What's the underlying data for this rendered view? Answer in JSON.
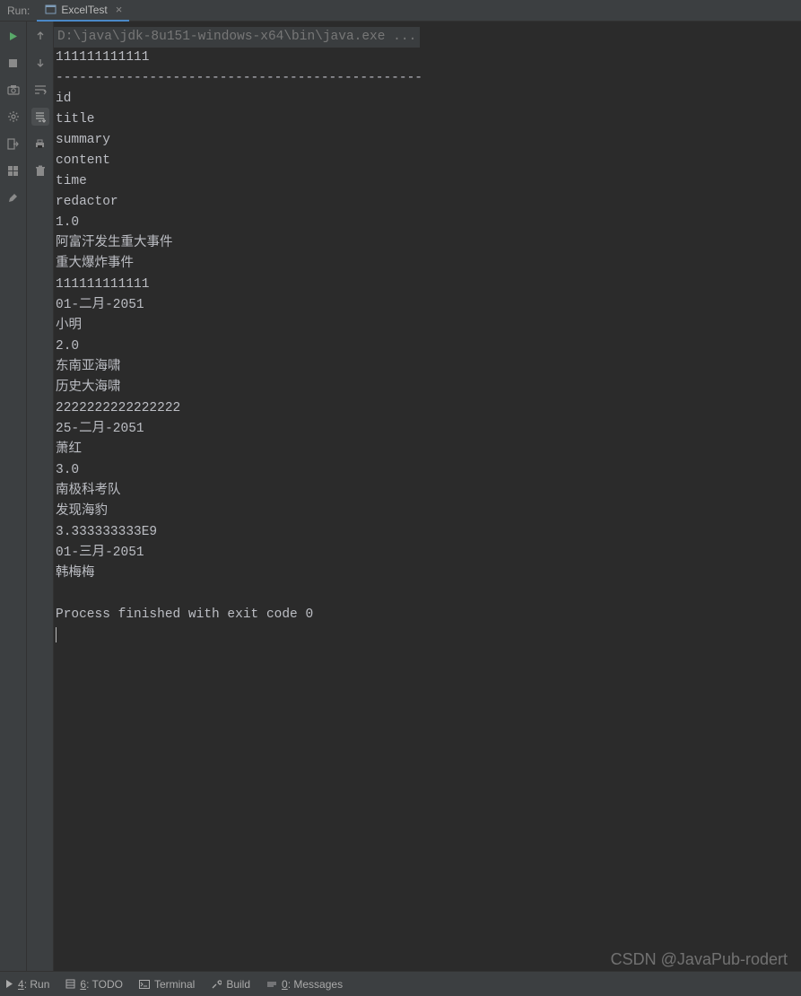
{
  "header": {
    "label": "Run:",
    "tab": {
      "label": "ExcelTest",
      "icon": "run-config-icon"
    }
  },
  "console": {
    "command": "D:\\java\\jdk-8u151-windows-x64\\bin\\java.exe ...",
    "lines": [
      "111111111111",
      "-----------------------------------------------",
      "id",
      "title",
      "summary",
      "content",
      "time",
      "redactor",
      "1.0",
      "阿富汗发生重大事件",
      "重大爆炸事件",
      "111111111111",
      "01-二月-2051",
      "小明",
      "2.0",
      "东南亚海啸",
      "历史大海啸",
      "2222222222222222",
      "25-二月-2051",
      "萧红",
      "3.0",
      "南极科考队",
      "发现海豹",
      "3.333333333E9",
      "01-三月-2051",
      "韩梅梅",
      "",
      "Process finished with exit code 0"
    ]
  },
  "footer": {
    "run": "4: Run",
    "todo": "6: TODO",
    "terminal": "Terminal",
    "build": "Build",
    "messages": "0: Messages"
  },
  "watermark": "CSDN @JavaPub-rodert"
}
